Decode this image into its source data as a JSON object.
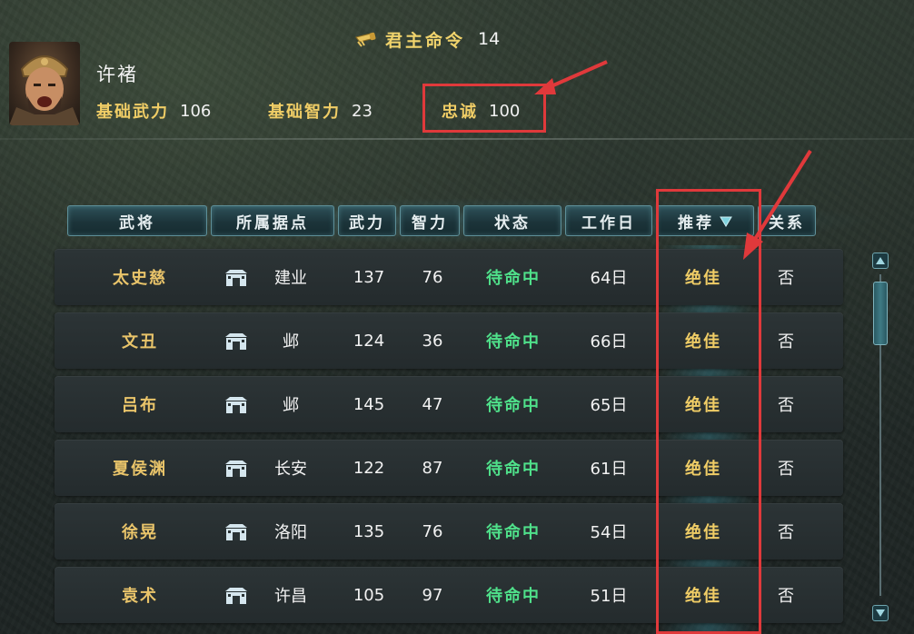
{
  "command": {
    "label": "君主命令",
    "value": "14"
  },
  "hero": {
    "name": "许褚",
    "stats": [
      {
        "key": "基础武力",
        "value": "106"
      },
      {
        "key": "基础智力",
        "value": "23"
      },
      {
        "key": "忠诚",
        "value": "100"
      }
    ]
  },
  "table": {
    "headers": [
      "武将",
      "所属据点",
      "武力",
      "智力",
      "状态",
      "工作日",
      "推荐",
      "关系"
    ],
    "rows": [
      {
        "name": "太史慈",
        "base": "建业",
        "wu": "137",
        "zhi": "76",
        "state": "待命中",
        "day": "64日",
        "rec": "绝佳",
        "rel": "否"
      },
      {
        "name": "文丑",
        "base": "邺",
        "wu": "124",
        "zhi": "36",
        "state": "待命中",
        "day": "66日",
        "rec": "绝佳",
        "rel": "否"
      },
      {
        "name": "吕布",
        "base": "邺",
        "wu": "145",
        "zhi": "47",
        "state": "待命中",
        "day": "65日",
        "rec": "绝佳",
        "rel": "否"
      },
      {
        "name": "夏侯渊",
        "base": "长安",
        "wu": "122",
        "zhi": "87",
        "state": "待命中",
        "day": "61日",
        "rec": "绝佳",
        "rel": "否"
      },
      {
        "name": "徐晃",
        "base": "洛阳",
        "wu": "135",
        "zhi": "76",
        "state": "待命中",
        "day": "54日",
        "rec": "绝佳",
        "rel": "否"
      },
      {
        "name": "袁术",
        "base": "许昌",
        "wu": "105",
        "zhi": "97",
        "state": "待命中",
        "day": "51日",
        "rec": "绝佳",
        "rel": "否"
      }
    ]
  },
  "icons": {
    "command": "scroll-icon",
    "base": "castle-icon",
    "sort": "sort-down-icon"
  },
  "colors": {
    "gold": "#f0cd66",
    "green": "#4fe08a",
    "highlight": "#e0393b"
  }
}
